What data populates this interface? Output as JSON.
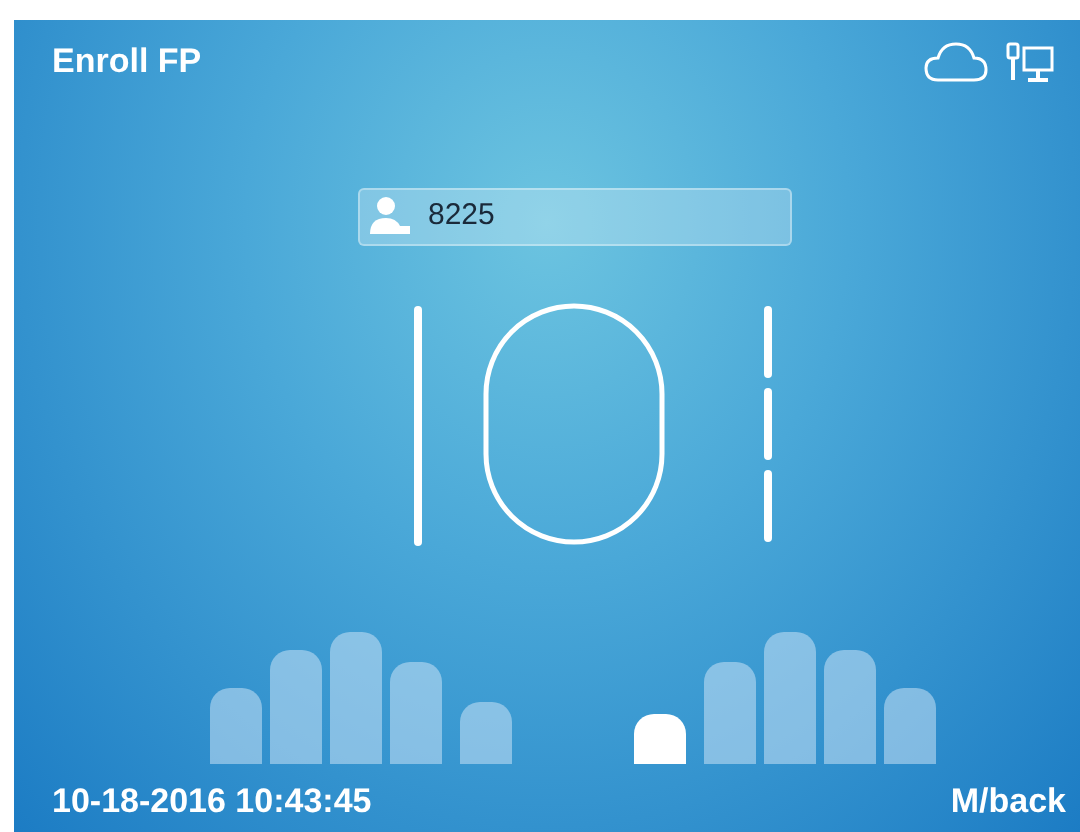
{
  "header": {
    "title": "Enroll FP"
  },
  "user_id": {
    "value": "8225"
  },
  "fingers": [
    {
      "selected": false
    },
    {
      "selected": false
    },
    {
      "selected": false
    },
    {
      "selected": false
    },
    {
      "selected": false
    },
    {
      "selected": true
    },
    {
      "selected": false
    },
    {
      "selected": false
    },
    {
      "selected": false
    },
    {
      "selected": false
    }
  ],
  "footer": {
    "datetime": "10-18-2016 10:43:45",
    "back_hint": "M/back"
  }
}
